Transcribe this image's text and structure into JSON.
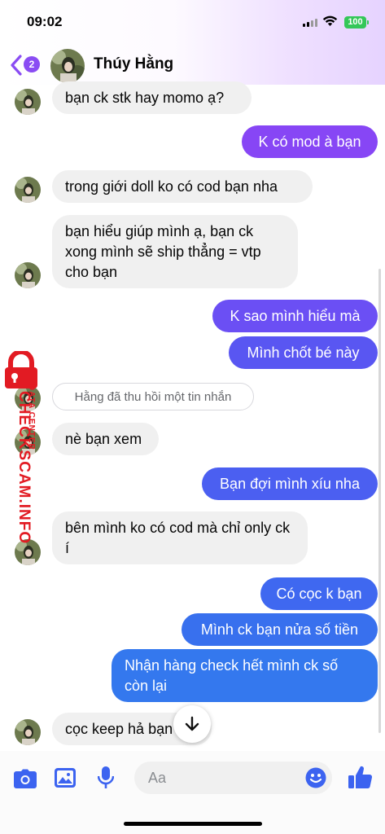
{
  "status_bar": {
    "time": "09:02",
    "battery": "100"
  },
  "header": {
    "back_count": "2",
    "contact_name": "Thúy Hằng"
  },
  "messages": [
    {
      "dir": "in",
      "text": "bạn ck stk hay momo ạ?"
    },
    {
      "dir": "out",
      "text": "K có mod à bạn"
    },
    {
      "dir": "in",
      "text": "trong giới doll ko có cod bạn nha"
    },
    {
      "dir": "in",
      "text": "bạn hiểu giúp mình ạ, bạn ck xong mình sẽ ship thẳng = vtp cho bạn"
    },
    {
      "dir": "out",
      "text": "K sao mình hiểu mà"
    },
    {
      "dir": "out",
      "text": "Mình chốt bé này"
    },
    {
      "dir": "in",
      "text": "nè bạn xem"
    },
    {
      "dir": "out",
      "text": "Bạn đợi mình xíu nha"
    },
    {
      "dir": "in",
      "text": "bên mình ko có cod mà chỉ only ck í"
    },
    {
      "dir": "out",
      "text": "Có cọc k bạn"
    },
    {
      "dir": "out",
      "text": "Mình ck bạn nửa số tiền"
    },
    {
      "dir": "out",
      "text": "Nhận hàng check hết mình ck số còn lại"
    },
    {
      "dir": "in",
      "text": "cọc keep hả bạn"
    }
  ],
  "system_notice": "Hằng đã thu hồi một tin nhắn",
  "watermark": {
    "text": "CHECKSCAM.INFO",
    "subtext": "DATA CENTER"
  },
  "composer": {
    "placeholder": "Aa"
  },
  "colors": {
    "accent": "#8a4cf3",
    "incoming_bubble": "#f0f0f0",
    "outgoing_top": "#8746f5",
    "outgoing_bottom": "#3478ee"
  }
}
